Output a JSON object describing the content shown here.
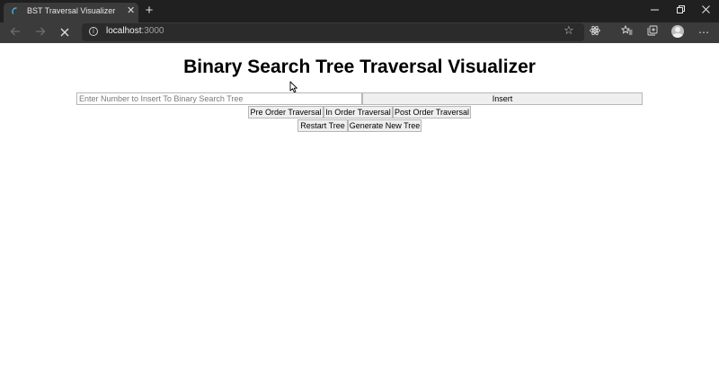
{
  "browser": {
    "tab_title": "BST Traversal Visualizer",
    "url_host": "localhost",
    "url_port": ":3000"
  },
  "page": {
    "title": "Binary Search Tree Traversal Visualizer",
    "input_placeholder": "Enter Number to Insert To Binary Search Tree",
    "input_value": "",
    "insert_label": "Insert",
    "pre_order_label": "Pre Order Traversal",
    "in_order_label": "In Order Traversal",
    "post_order_label": "Post Order Traversal",
    "restart_label": "Restart Tree",
    "generate_label": "Generate New Tree"
  },
  "icons": {
    "back": "back-arrow-icon",
    "forward": "forward-arrow-icon",
    "stop": "close-icon",
    "info": "info-icon",
    "favorite": "star-icon",
    "extension": "react-devtools-icon",
    "favorites_list": "favorites-icon",
    "collections": "collections-icon",
    "profile": "avatar",
    "menu": "more-icon"
  },
  "colors": {
    "tabstrip_bg": "#202020",
    "toolbar_bg": "#3b3b3b",
    "address_bg": "#2b2b2b",
    "button_bg": "#efefef",
    "page_bg": "#ffffff"
  }
}
